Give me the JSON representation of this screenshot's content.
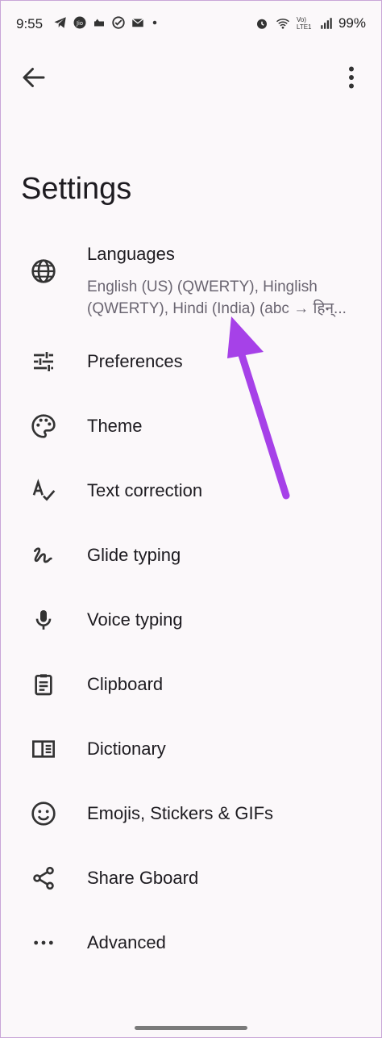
{
  "status": {
    "time": "9:55",
    "battery": "99%",
    "network": "Vo) LTE1"
  },
  "page": {
    "title": "Settings"
  },
  "languages": {
    "label": "Languages",
    "subtitle": "English (US) (QWERTY), Hinglish (QWERTY), Hindi (India) (abc → हिन्..."
  },
  "items": [
    {
      "label": "Preferences",
      "icon": "tune-icon"
    },
    {
      "label": "Theme",
      "icon": "palette-icon"
    },
    {
      "label": "Text correction",
      "icon": "spellcheck-icon"
    },
    {
      "label": "Glide typing",
      "icon": "gesture-icon"
    },
    {
      "label": "Voice typing",
      "icon": "mic-icon"
    },
    {
      "label": "Clipboard",
      "icon": "clipboard-icon"
    },
    {
      "label": "Dictionary",
      "icon": "dictionary-icon"
    },
    {
      "label": "Emojis, Stickers & GIFs",
      "icon": "emoji-icon"
    },
    {
      "label": "Share Gboard",
      "icon": "share-icon"
    },
    {
      "label": "Advanced",
      "icon": "more-horiz-icon"
    }
  ],
  "colors": {
    "accent": "#a641e8",
    "background": "#fbf8fa",
    "text": "#1d1b20",
    "subtext": "#6a6571"
  }
}
